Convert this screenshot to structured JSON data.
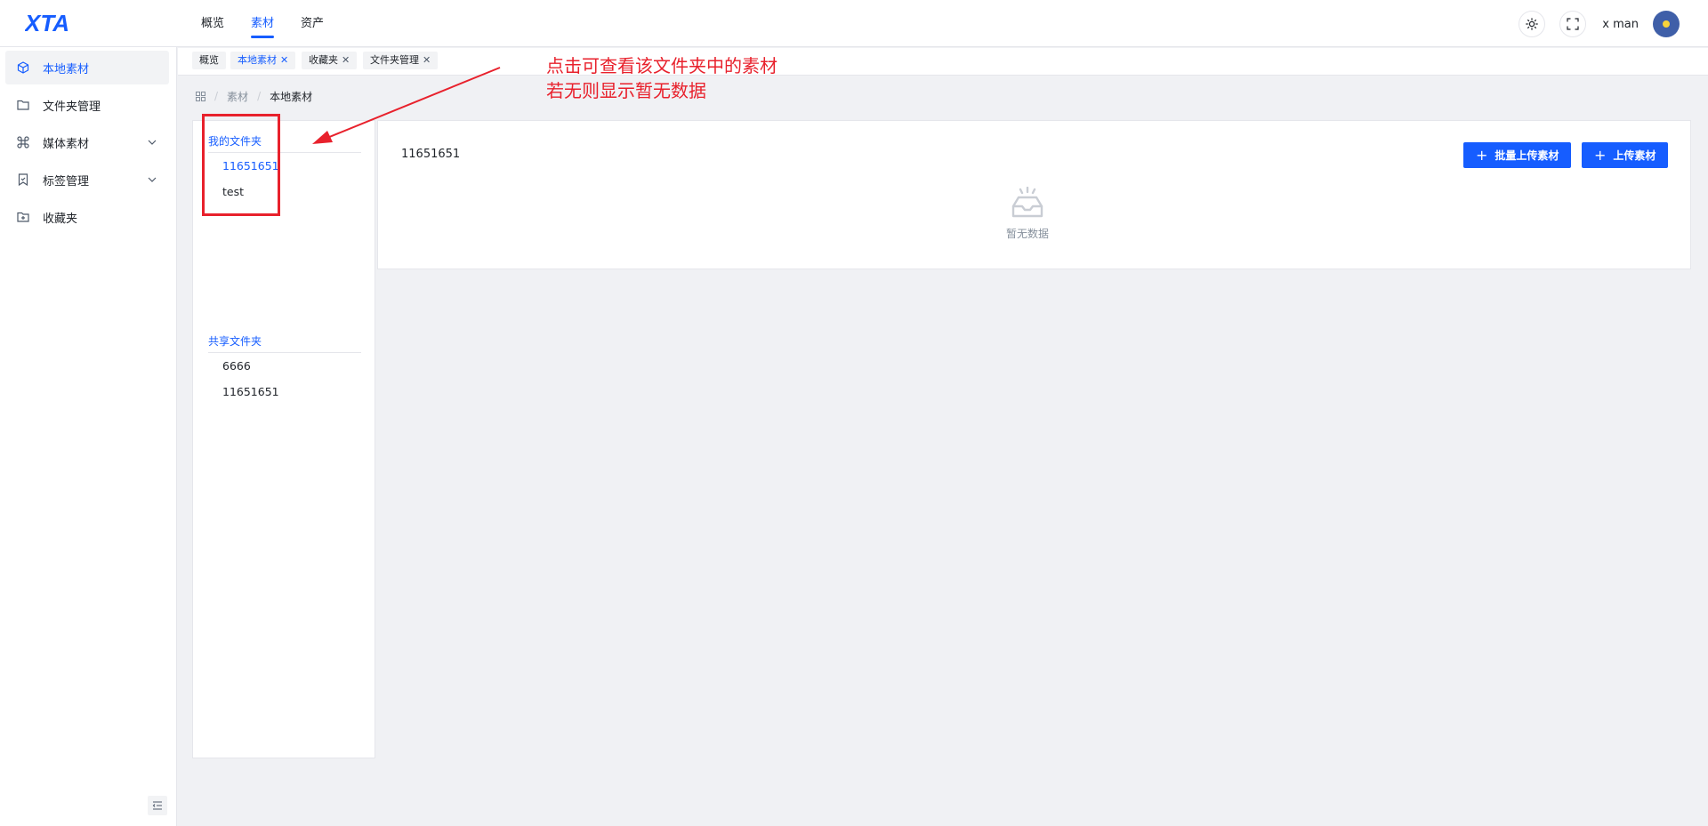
{
  "header": {
    "logo_text": "XTA",
    "nav": [
      {
        "label": "概览",
        "active": false
      },
      {
        "label": "素材",
        "active": true
      },
      {
        "label": "资产",
        "active": false
      }
    ],
    "username": "x man"
  },
  "sidebar": {
    "items": [
      {
        "label": "本地素材",
        "icon": "cube-icon",
        "active": true,
        "expandable": false
      },
      {
        "label": "文件夹管理",
        "icon": "folder-icon",
        "active": false,
        "expandable": false
      },
      {
        "label": "媒体素材",
        "icon": "command-icon",
        "active": false,
        "expandable": true
      },
      {
        "label": "标签管理",
        "icon": "bookmark-icon",
        "active": false,
        "expandable": true
      },
      {
        "label": "收藏夹",
        "icon": "folder-add-icon",
        "active": false,
        "expandable": false
      }
    ]
  },
  "tabs": [
    {
      "label": "概览",
      "closable": false,
      "active": false
    },
    {
      "label": "本地素材",
      "closable": true,
      "active": true
    },
    {
      "label": "收藏夹",
      "closable": true,
      "active": false
    },
    {
      "label": "文件夹管理",
      "closable": true,
      "active": false
    }
  ],
  "breadcrumb": {
    "items": [
      "素材",
      "本地素材"
    ]
  },
  "folders": {
    "my_title": "我的文件夹",
    "my_items": [
      {
        "label": "11651651",
        "active": true
      },
      {
        "label": "test",
        "active": false
      }
    ],
    "shared_title": "共享文件夹",
    "shared_items": [
      {
        "label": "6666",
        "active": false
      },
      {
        "label": "11651651",
        "active": false
      }
    ]
  },
  "content": {
    "folder_title": "11651651",
    "batch_upload_label": "批量上传素材",
    "upload_label": "上传素材",
    "empty_text": "暂无数据"
  },
  "annotation": {
    "text": "点击可查看该文件夹中的素材\n若无则显示暂无数据",
    "color": "#e8212c"
  },
  "colors": {
    "primary": "#165dff",
    "annotation": "#e8212c"
  }
}
